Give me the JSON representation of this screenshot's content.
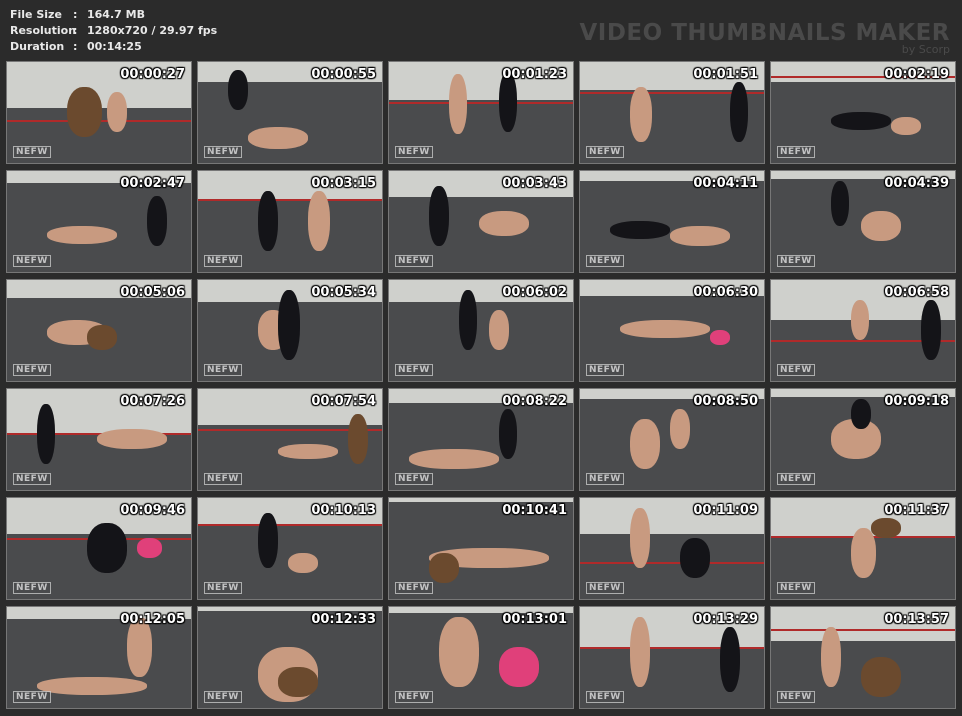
{
  "header": {
    "file_size_label": "File Size",
    "file_size_value": "164.7 MB",
    "resolution_label": "Resolution",
    "resolution_value": "1280x720 / 29.97 fps",
    "duration_label": "Duration",
    "duration_value": "00:14:25",
    "separator": ":"
  },
  "brand": {
    "title": "VIDEO THUMBNAILS MAKER",
    "subtitle": "by Scorp"
  },
  "thumbnails": [
    {
      "time": "00:00:27",
      "logo": "NEFW"
    },
    {
      "time": "00:00:55",
      "logo": "NEFW"
    },
    {
      "time": "00:01:23",
      "logo": "NEFW"
    },
    {
      "time": "00:01:51",
      "logo": "NEFW"
    },
    {
      "time": "00:02:19",
      "logo": "NEFW"
    },
    {
      "time": "00:02:47",
      "logo": "NEFW"
    },
    {
      "time": "00:03:15",
      "logo": "NEFW"
    },
    {
      "time": "00:03:43",
      "logo": "NEFW"
    },
    {
      "time": "00:04:11",
      "logo": "NEFW"
    },
    {
      "time": "00:04:39",
      "logo": "NEFW"
    },
    {
      "time": "00:05:06",
      "logo": "NEFW"
    },
    {
      "time": "00:05:34",
      "logo": "NEFW"
    },
    {
      "time": "00:06:02",
      "logo": "NEFW"
    },
    {
      "time": "00:06:30",
      "logo": "NEFW"
    },
    {
      "time": "00:06:58",
      "logo": "NEFW"
    },
    {
      "time": "00:07:26",
      "logo": "NEFW"
    },
    {
      "time": "00:07:54",
      "logo": "NEFW"
    },
    {
      "time": "00:08:22",
      "logo": "NEFW"
    },
    {
      "time": "00:08:50",
      "logo": "NEFW"
    },
    {
      "time": "00:09:18",
      "logo": "NEFW"
    },
    {
      "time": "00:09:46",
      "logo": "NEFW"
    },
    {
      "time": "00:10:13",
      "logo": "NEFW"
    },
    {
      "time": "00:10:41",
      "logo": "NEFW"
    },
    {
      "time": "00:11:09",
      "logo": "NEFW"
    },
    {
      "time": "00:11:37",
      "logo": "NEFW"
    },
    {
      "time": "00:12:05",
      "logo": "NEFW"
    },
    {
      "time": "00:12:33",
      "logo": "NEFW"
    },
    {
      "time": "00:13:01",
      "logo": "NEFW"
    },
    {
      "time": "00:13:29",
      "logo": "NEFW"
    },
    {
      "time": "00:13:57",
      "logo": "NEFW"
    }
  ]
}
